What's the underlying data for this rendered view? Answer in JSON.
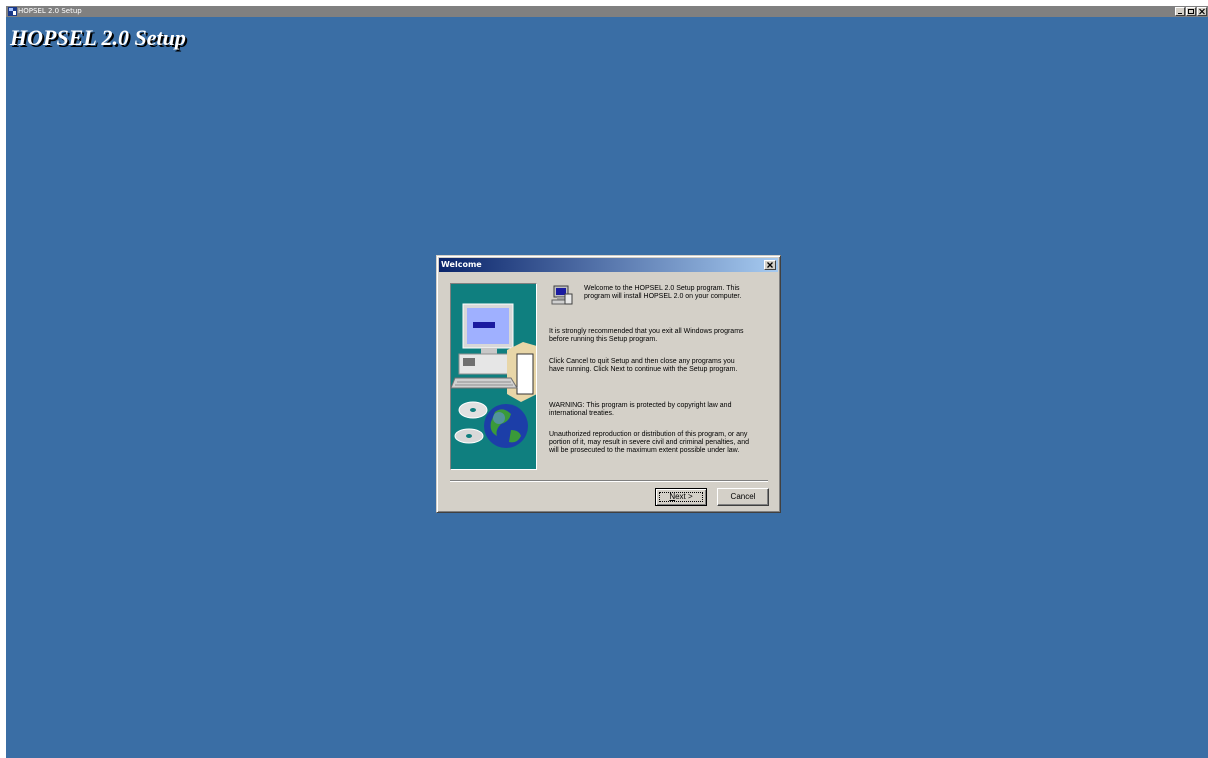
{
  "window": {
    "title": "HOPSEL 2.0 Setup",
    "banner_title": "HOPSEL 2.0 Setup",
    "background_color": "#3a6ea5",
    "controls": [
      "minimize-icon",
      "maximize-icon",
      "close-icon"
    ]
  },
  "dialog": {
    "title": "Welcome",
    "close_glyph": "×",
    "paragraphs": {
      "welcome_1": "Welcome to the HOPSEL 2.0 Setup program.  This",
      "welcome_2": "program will install HOPSEL 2.0 on your computer.",
      "recommend_1": "It is strongly recommended that you exit all Windows programs",
      "recommend_2": "before running this Setup program.",
      "cancel_1": "Click Cancel to quit Setup and then close any programs you",
      "cancel_2": "have running.  Click Next to continue with the Setup program.",
      "warning_1": "WARNING: This program is protected by copyright law and",
      "warning_2": "international treaties.",
      "unauth_1": "Unauthorized reproduction or distribution of this program, or any",
      "unauth_2": "portion of it, may result in severe civil and criminal penalties, and",
      "unauth_3": "will be prosecuted to the maximum extent possible under law."
    },
    "buttons": {
      "next_mnemonic": "N",
      "next_rest": "ext >",
      "cancel": "Cancel"
    },
    "side_panel_color": "#0f7f7f"
  }
}
